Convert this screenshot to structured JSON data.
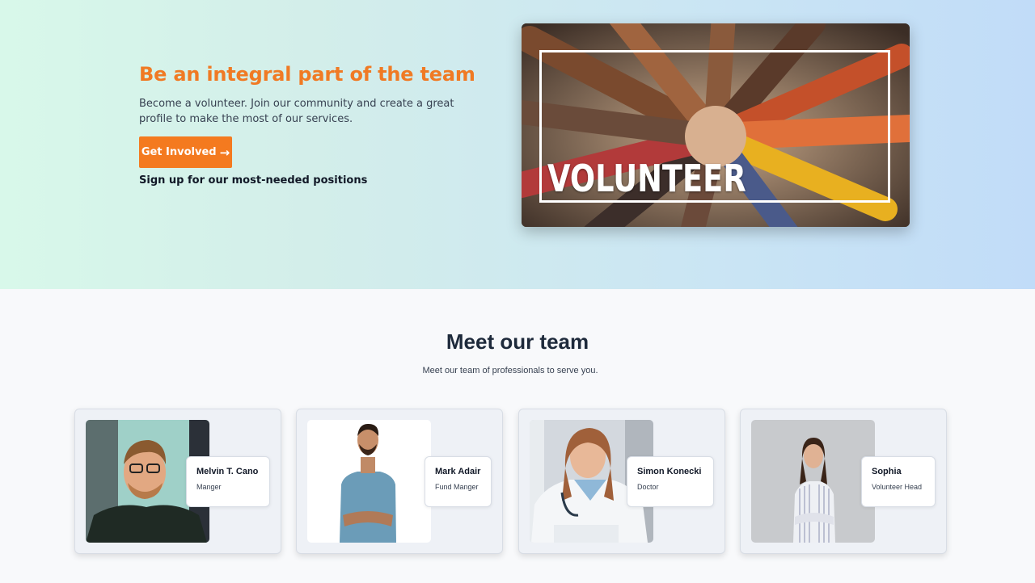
{
  "hero": {
    "title": "Be an integral part of the team",
    "text": "Become a volunteer. Join our community and create a great profile to make the most of our services.",
    "button_label": "Get Involved",
    "button_arrow": "→",
    "link_text": "Sign up for our most-needed positions",
    "image_word": "VOLUNTEER",
    "accent_color": "#f47a1f"
  },
  "team": {
    "title": "Meet our team",
    "subtitle": "Meet our team of professionals to serve you.",
    "members": [
      {
        "name": "Melvin T. Cano",
        "role": "Manger"
      },
      {
        "name": "Mark Adair",
        "role": "Fund Manger"
      },
      {
        "name": "Simon Konecki",
        "role": "Doctor"
      },
      {
        "name": "Sophia",
        "role": "Volunteer Head"
      }
    ]
  }
}
